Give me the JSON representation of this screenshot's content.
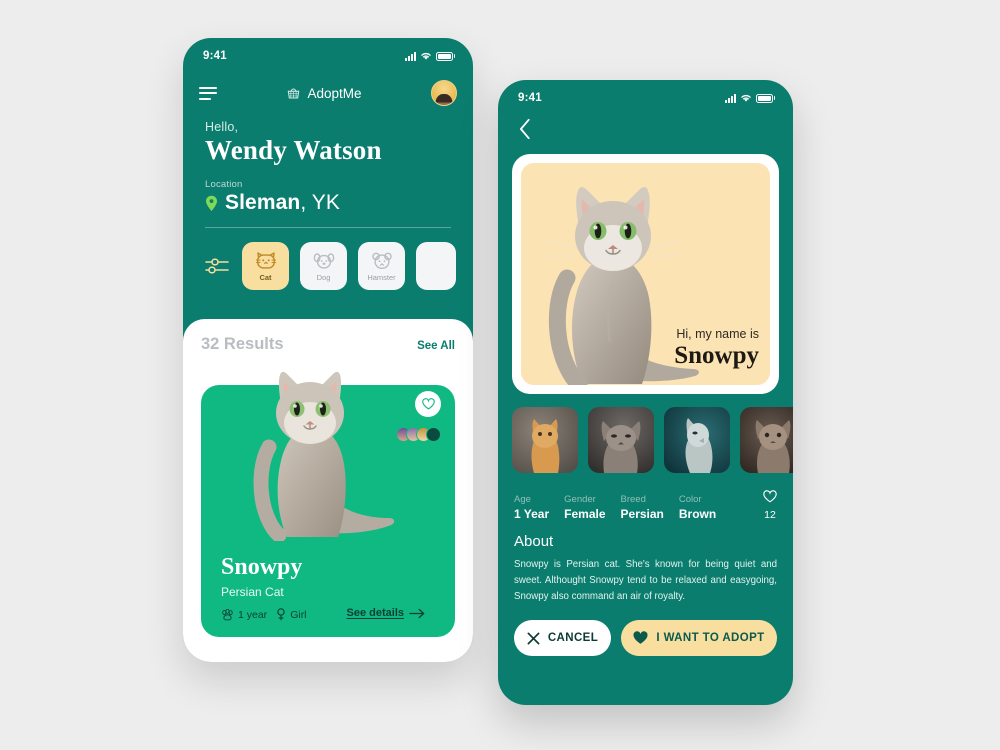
{
  "theme": {
    "teal": "#0a7d6e",
    "green": "#10b981",
    "cream": "#f8dfa0",
    "page_bg": "#ededed"
  },
  "home": {
    "status_bar": {
      "time": "9:41",
      "signal_icon": "signal-icon",
      "wifi_icon": "wifi-icon",
      "battery_icon": "battery-icon"
    },
    "appbar": {
      "menu_icon": "hamburger-menu-icon",
      "brand": "AdoptMe",
      "brand_icon": "basket-icon",
      "avatar": "user-avatar"
    },
    "greeting": {
      "hello": "Hello,",
      "name": "Wendy Watson"
    },
    "location": {
      "label": "Location",
      "pin_icon": "location-pin-icon",
      "city": "Sleman",
      "region": ", YK"
    },
    "filters": {
      "settings_icon": "sliders-filter-icon",
      "chips": [
        {
          "label": "Cat",
          "icon": "cat-icon",
          "active": true
        },
        {
          "label": "Dog",
          "icon": "dog-icon",
          "active": false
        },
        {
          "label": "Hamster",
          "icon": "hamster-icon",
          "active": false
        }
      ]
    },
    "results": {
      "count_label": "32 Results",
      "see_all": "See All"
    },
    "pet_card": {
      "name": "Snowpy",
      "breed": "Persian Cat",
      "age": "1 year",
      "age_icon": "paw-icon",
      "gender": "Girl",
      "gender_icon": "female-icon",
      "favorite_icon": "heart-outline-icon",
      "see_details": "See details",
      "arrow_icon": "arrow-right-icon",
      "watchers_icon": "avatar-group"
    }
  },
  "detail": {
    "status_bar": {
      "time": "9:41",
      "signal_icon": "signal-icon",
      "wifi_icon": "wifi-icon",
      "battery_icon": "battery-icon"
    },
    "back_icon": "chevron-left-icon",
    "hero": {
      "greeting": "Hi, my name is",
      "name": "Snowpy"
    },
    "thumbnails": [
      "cat-thumb-1",
      "cat-thumb-2",
      "cat-thumb-3",
      "cat-thumb-4"
    ],
    "attributes": [
      {
        "key": "Age",
        "value": "1 Year"
      },
      {
        "key": "Gender",
        "value": "Female"
      },
      {
        "key": "Breed",
        "value": "Persian"
      },
      {
        "key": "Color",
        "value": "Brown"
      }
    ],
    "likes": {
      "icon": "heart-outline-icon",
      "count": "12"
    },
    "about": {
      "heading": "About",
      "text": "Snowpy is Persian cat. She's known for being quiet and sweet. Althought Snowpy tend to be relaxed and easygoing, Snowpy also command an air of royalty."
    },
    "actions": {
      "cancel": {
        "label": "CANCEL",
        "icon": "close-x-icon"
      },
      "adopt": {
        "label": "I WANT TO ADOPT",
        "icon": "heart-filled-icon"
      }
    }
  }
}
